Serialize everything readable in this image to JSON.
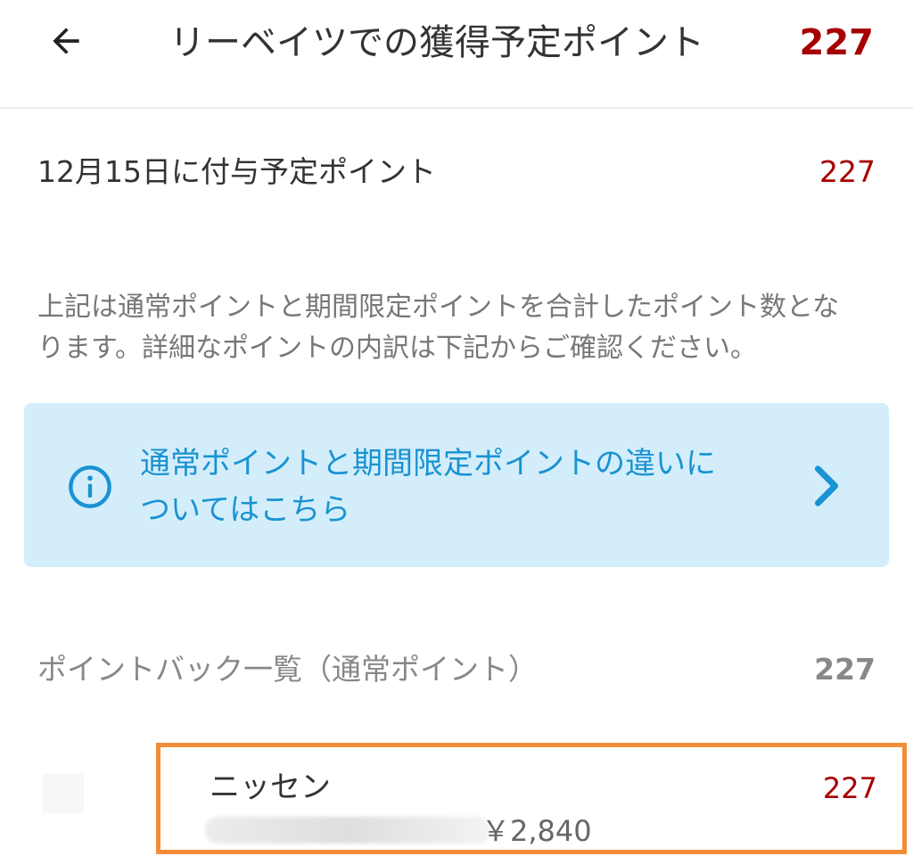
{
  "header": {
    "back_icon": "arrow-left-icon",
    "title": "リーベイツでの獲得予定ポイント",
    "total_points": "227"
  },
  "grant": {
    "label": "12月15日に付与予定ポイント",
    "points": "227"
  },
  "notice": {
    "line1": "上記は通常ポイントと期間限定ポイントを合計したポイント数とな",
    "line2": "ります。詳細なポイントの内訳は下記からご確認ください。"
  },
  "info_box": {
    "icon": "info-circle-icon",
    "line1": "通常ポイントと期間限定ポイントの違いに",
    "line2": "ついてはこちら",
    "chevron_icon": "chevron-right-icon"
  },
  "pointback": {
    "label": "ポイントバック一覧（通常ポイント）",
    "total": "227",
    "items": [
      {
        "name": "ニッセン",
        "points": "227",
        "price": "￥2,840"
      }
    ]
  },
  "colors": {
    "points_red": "#a70000",
    "info_bg": "#d3eefa",
    "info_blue": "#1a92d3",
    "highlight_orange": "#f28c36"
  }
}
